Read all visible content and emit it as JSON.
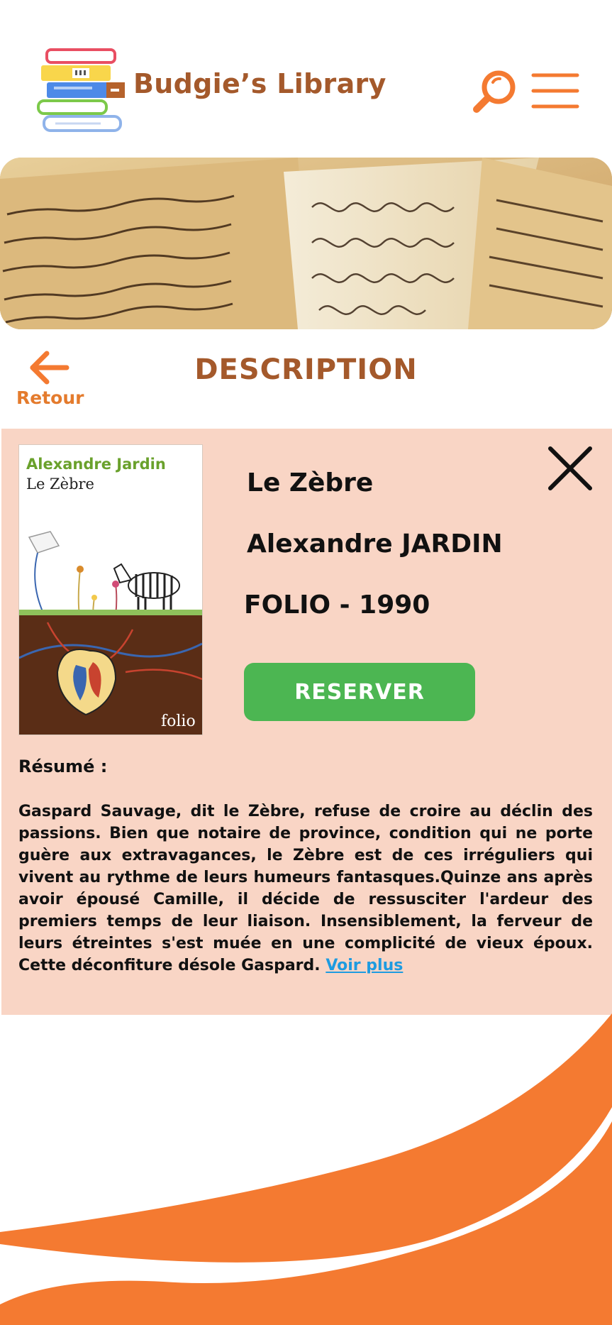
{
  "header": {
    "app_title": "Budgie’s Library",
    "logo_icon": "books-stack-icon",
    "search_icon": "search-icon",
    "menu_icon": "hamburger-menu-icon"
  },
  "banner": {
    "image": "old-manuscript-pages-image"
  },
  "nav": {
    "back_label": "Retour",
    "back_icon": "arrow-left-icon"
  },
  "page": {
    "section_title": "DESCRIPTION"
  },
  "book": {
    "title": "Le Zèbre",
    "author": "Alexandre JARDIN",
    "publisher_year": "FOLIO - 1990",
    "cover": {
      "author_line": "Alexandre Jardin",
      "title_line": "Le Zèbre",
      "imprint": "folio"
    },
    "reserve_label": "RESERVER",
    "close_icon": "close-icon",
    "resume_label": "Résumé :",
    "resume_text": "Gaspard Sauvage, dit le Zèbre, refuse de croire au déclin des passions. Bien que notaire de province, condition qui ne porte guère aux extravagances, le Zèbre est de ces irréguliers qui vivent au rythme de leurs humeurs fantasques.Quinze ans après avoir épousé Camille, il décide de ressusciter l'ardeur des premiers temps de leur liaison. Insensiblement, la ferveur de leurs étreintes s'est muée en une complicité de vieux époux. Cette déconfiture désole Gaspard.",
    "more_link": "Voir plus"
  },
  "colors": {
    "brand_brown": "#a4592b",
    "accent_orange": "#f47a31",
    "card_background": "#f9d5c5",
    "reserve_green": "#4cb652",
    "link_blue": "#1e9be0"
  }
}
